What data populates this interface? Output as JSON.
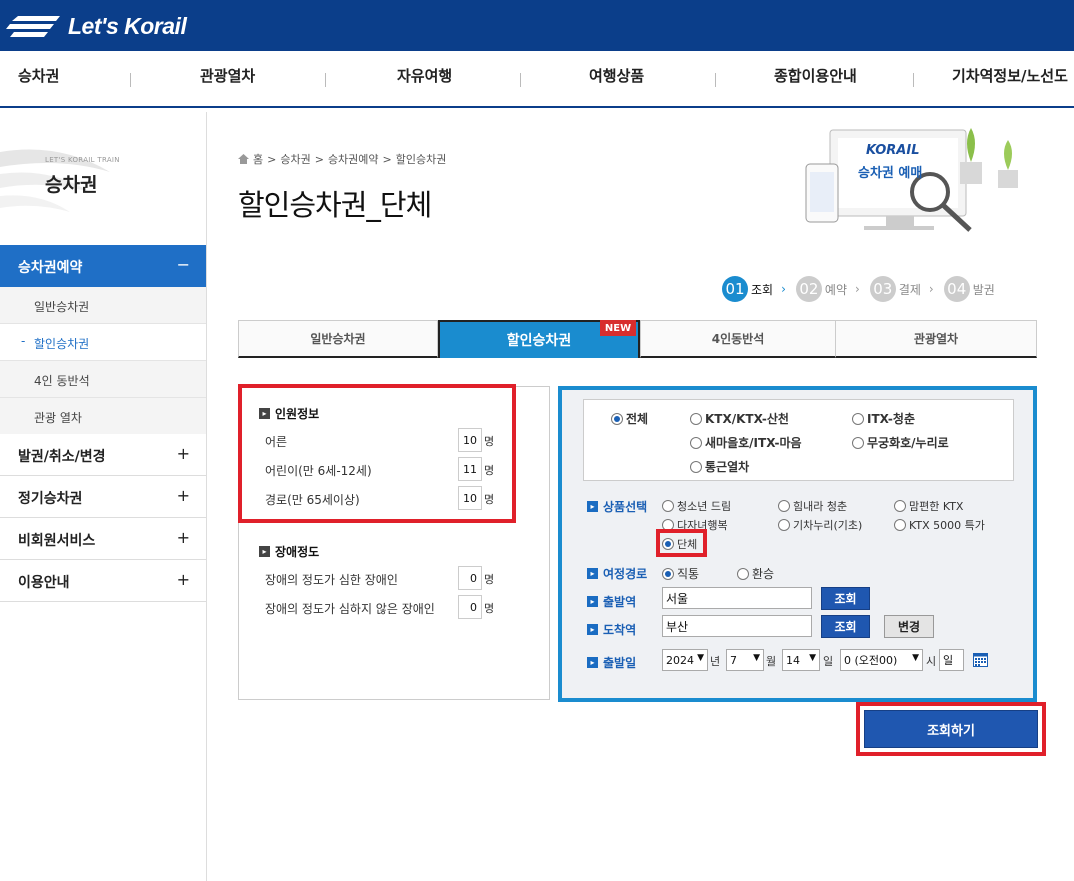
{
  "header": {
    "logo_text": "Let's Korail",
    "brand_color": "#0b3e8a"
  },
  "gnb": [
    "승차권",
    "관광열차",
    "자유여행",
    "여행상품",
    "종합이용안내",
    "기차역정보/노선도"
  ],
  "lnb": {
    "sub": "LET'S KORAIL TRAIN",
    "title": "승차권",
    "active": "승차권예약",
    "active_toggle": "−",
    "subitems": [
      "일반승차권",
      "할인승차권",
      "4인 동반석",
      "관광 열차"
    ],
    "current_dash": "-",
    "menus": [
      "발권/취소/변경",
      "정기승차권",
      "비회원서비스",
      "이용안내"
    ],
    "expand": "+"
  },
  "breadcrumb": [
    "홈",
    "승차권",
    "승차권예약",
    "할인승차권"
  ],
  "breadcrumb_sep": ">",
  "page_title": "할인승차권_단체",
  "banner": {
    "brand": "KORAIL",
    "caption": "승차권 예매"
  },
  "steps": [
    {
      "num": "01",
      "label": "조회"
    },
    {
      "num": "02",
      "label": "예약"
    },
    {
      "num": "03",
      "label": "결제"
    },
    {
      "num": "04",
      "label": "발권"
    }
  ],
  "tabs": [
    "일반승차권",
    "할인승차권",
    "4인동반석",
    "관광열차"
  ],
  "new_badge": "NEW",
  "person": {
    "title": "인원정보",
    "rows": [
      {
        "label": "어른",
        "value": "10",
        "unit": "명"
      },
      {
        "label": "어린이(만 6세-12세)",
        "value": "11",
        "unit": "명"
      },
      {
        "label": "경로(만 65세이상)",
        "value": "10",
        "unit": "명"
      }
    ]
  },
  "disability": {
    "title": "장애정도",
    "rows": [
      {
        "label": "장애의 정도가 심한 장애인",
        "value": "0",
        "unit": "명"
      },
      {
        "label": "장애의 정도가 심하지 않은 장애인",
        "value": "0",
        "unit": "명"
      }
    ]
  },
  "train_types": [
    "전체",
    "KTX/KTX-산천",
    "ITX-청춘",
    "새마을호/ITX-마음",
    "무궁화호/누리로",
    "통근열차"
  ],
  "product": {
    "label": "상품선택",
    "options": [
      "청소년 드림",
      "힘내라 청춘",
      "맘편한 KTX",
      "다자녀행복",
      "기차누리(기초)",
      "KTX 5000 특가",
      "단체"
    ]
  },
  "route": {
    "label": "여정경로",
    "options": [
      "직통",
      "환승"
    ]
  },
  "departure": {
    "label": "출발역",
    "value": "서울",
    "button": "조회"
  },
  "arrival": {
    "label": "도착역",
    "value": "부산",
    "button": "조회",
    "swap": "변경"
  },
  "date": {
    "label": "출발일",
    "year": "2024",
    "year_unit": "년",
    "month": "7",
    "month_unit": "월",
    "day": "14",
    "day_unit": "일",
    "hour": "0 (오전00)",
    "hour_unit": "시",
    "weekday": "일"
  },
  "search_button": "조회하기",
  "highlight_color": "#e0202a"
}
